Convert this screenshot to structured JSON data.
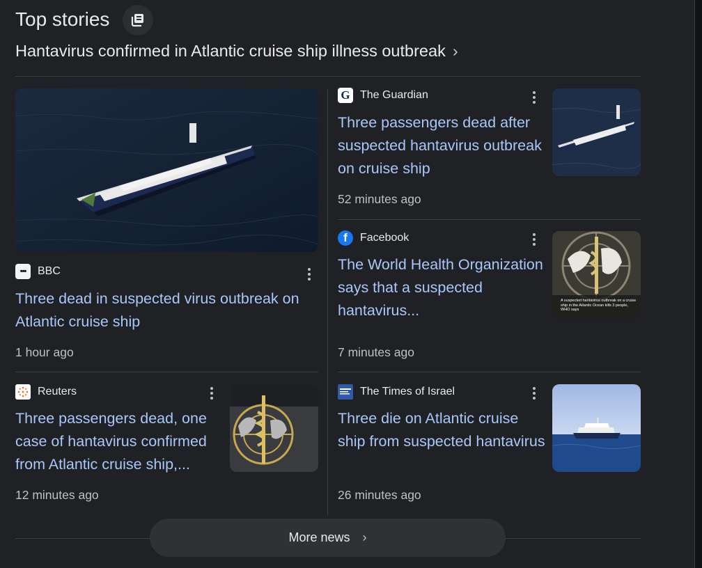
{
  "header": {
    "title": "Top stories",
    "icon": "stacked-pages-icon"
  },
  "topic": {
    "label": "Hantavirus confirmed in Atlantic cruise ship illness outbreak",
    "chevron": "›"
  },
  "stories": [
    {
      "source": "BBC",
      "logo_label": "•••",
      "headline": "Three dead in suspected virus outbreak on Atlantic cruise ship",
      "time": "1 hour ago"
    },
    {
      "source": "The Guardian",
      "logo_label": "G",
      "headline": "Three passengers dead after suspected hantavirus outbreak on cruise ship",
      "time": "52 minutes ago"
    },
    {
      "source": "Facebook",
      "logo_label": "f",
      "headline": "The World Health Organization says that a suspected hantavirus...",
      "time": "7 minutes ago",
      "thumb_caption": "A suspected hantavirus outbreak on a cruise ship in the Atlantic Ocean kills 3 people, WHO says"
    },
    {
      "source": "Reuters",
      "headline": "Three passengers dead, one case of hantavirus confirmed from Atlantic cruise ship,...",
      "time": "12 minutes ago"
    },
    {
      "source": "The Times of Israel",
      "headline": "Three die on Atlantic cruise ship from suspected hantavirus",
      "time": "26 minutes ago"
    }
  ],
  "more_button": {
    "label": "More news",
    "chevron": "›"
  },
  "colors": {
    "background": "#202124",
    "headline": "#a8c7fa",
    "meta": "#bdc1c6",
    "divider": "#3c4043",
    "button": "#303134"
  }
}
